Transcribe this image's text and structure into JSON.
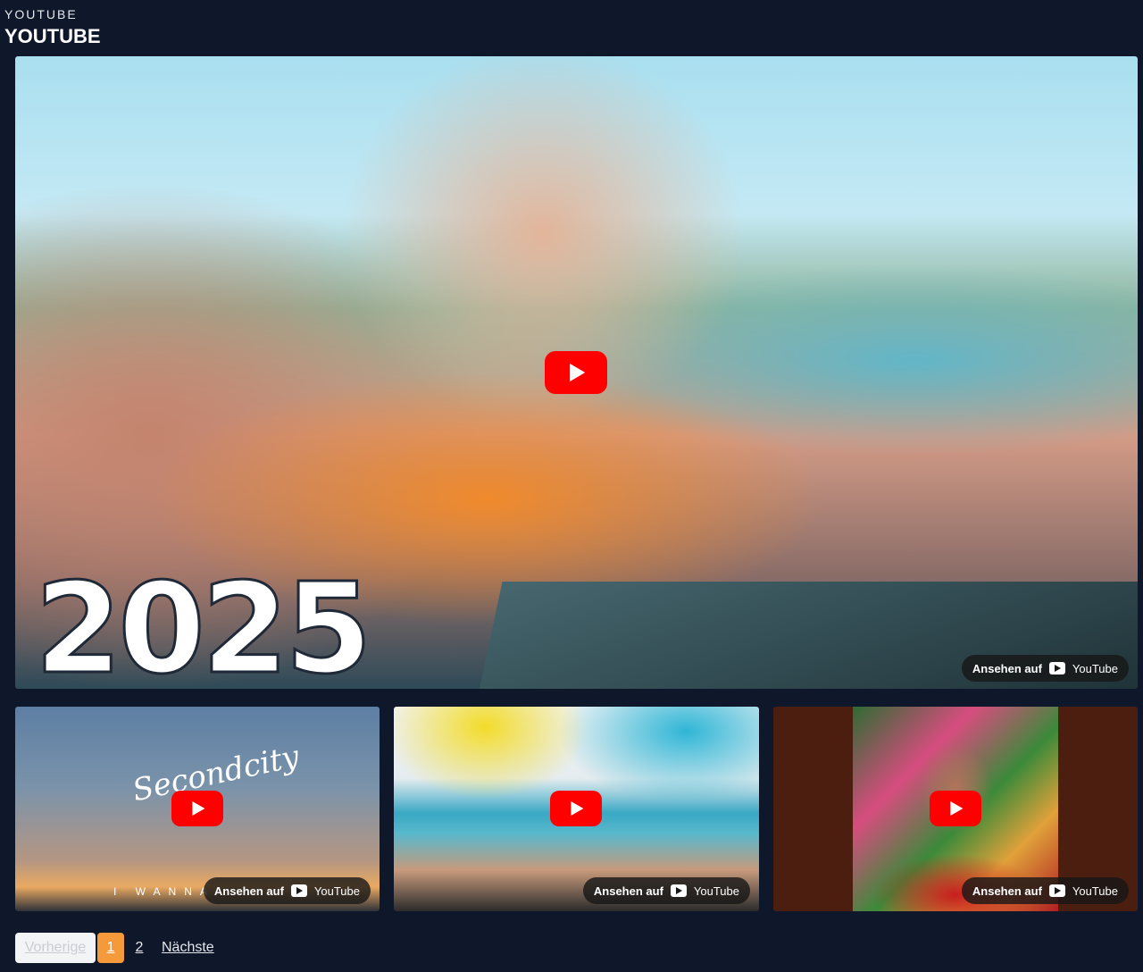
{
  "header": {
    "overline": "YOUTUBE",
    "title": "YOUTUBE"
  },
  "main_video": {
    "overlay_text": "2025",
    "watch_label": "Ansehen auf",
    "watch_brand": "YouTube"
  },
  "thumbnails": [
    {
      "overlay_title": "Secondcity",
      "overlay_caption": "I WANNA",
      "watch_label": "Ansehen auf",
      "watch_brand": "YouTube"
    },
    {
      "watch_label": "Ansehen auf",
      "watch_brand": "YouTube"
    },
    {
      "watch_label": "Ansehen auf",
      "watch_brand": "YouTube"
    }
  ],
  "pagination": {
    "prev_label": "Vorherige",
    "pages": [
      "1",
      "2"
    ],
    "current_page": "1",
    "next_label": "Nächste"
  },
  "colors": {
    "background": "#0f172a",
    "play_button": "#ff0000",
    "active_page": "#f59a3b"
  }
}
